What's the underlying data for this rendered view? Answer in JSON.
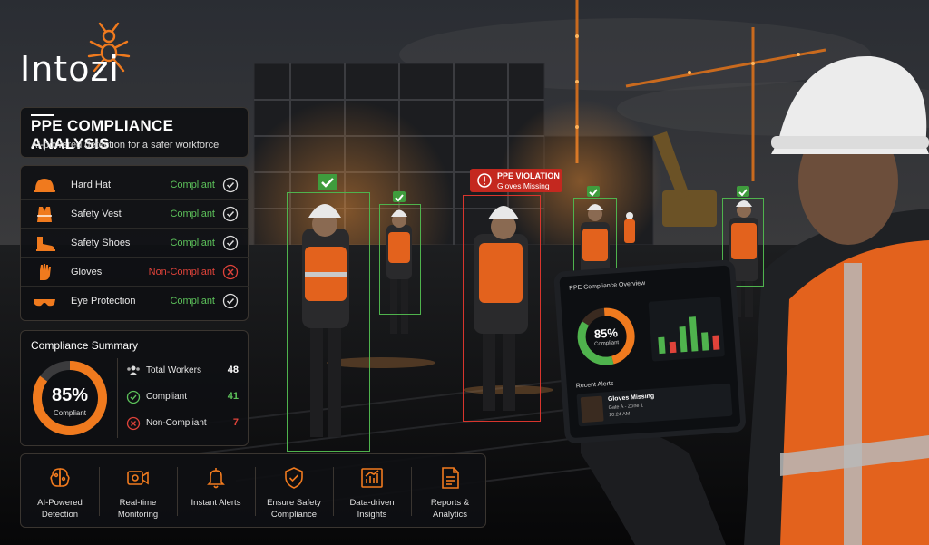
{
  "brand": {
    "name": "Intozi",
    "accent": "#f07a1e"
  },
  "header": {
    "title": "PPE COMPLIANCE ANALYSIS",
    "subtitle": "AI-powered detection for a safer workforce"
  },
  "ppe_items": [
    {
      "name": "Hard Hat",
      "status": "Compliant",
      "icon": "hard-hat-icon",
      "state": "ok"
    },
    {
      "name": "Safety Vest",
      "status": "Compliant",
      "icon": "safety-vest-icon",
      "state": "ok"
    },
    {
      "name": "Safety Shoes",
      "status": "Compliant",
      "icon": "safety-shoes-icon",
      "state": "ok"
    },
    {
      "name": "Gloves",
      "status": "Non-Compliant",
      "icon": "gloves-icon",
      "state": "bad"
    },
    {
      "name": "Eye Protection",
      "status": "Compliant",
      "icon": "eye-protection-icon",
      "state": "ok"
    }
  ],
  "summary": {
    "title": "Compliance Summary",
    "percent": "85%",
    "percent_value": 0.85,
    "percent_label": "Compliant",
    "rows": [
      {
        "label": "Total Workers",
        "value": "48",
        "icon": "workers-icon",
        "color": "#ffffff"
      },
      {
        "label": "Compliant",
        "value": "41",
        "icon": "check-circle-icon",
        "color": "#5cc15a"
      },
      {
        "label": "Non-Compliant",
        "value": "7",
        "icon": "x-circle-icon",
        "color": "#e0433a"
      }
    ]
  },
  "features": [
    {
      "label": "AI-Powered Detection",
      "icon": "ai-brain-icon"
    },
    {
      "label": "Real-time Monitoring",
      "icon": "video-camera-icon"
    },
    {
      "label": "Instant Alerts",
      "icon": "bell-icon"
    },
    {
      "label": "Ensure Safety Compliance",
      "icon": "shield-check-icon"
    },
    {
      "label": "Data-driven Insights",
      "icon": "bar-chart-icon"
    },
    {
      "label": "Reports & Analytics",
      "icon": "report-icon"
    }
  ],
  "violation": {
    "title": "PPE VIOLATION",
    "detail": "Gloves Missing"
  },
  "tablet": {
    "title": "PPE Compliance Overview",
    "percent": "85%",
    "percent_label": "Compliant",
    "alerts_title": "Recent Alerts",
    "alert": {
      "title": "Gloves Missing",
      "location": "Gate A - Zone 1",
      "time": "10:24 AM"
    }
  },
  "colors": {
    "ok": "#5cc15a",
    "bad": "#e0433a",
    "accent": "#f07a1e",
    "box_ok": "#4fb34d",
    "box_bad": "#d8352d"
  }
}
